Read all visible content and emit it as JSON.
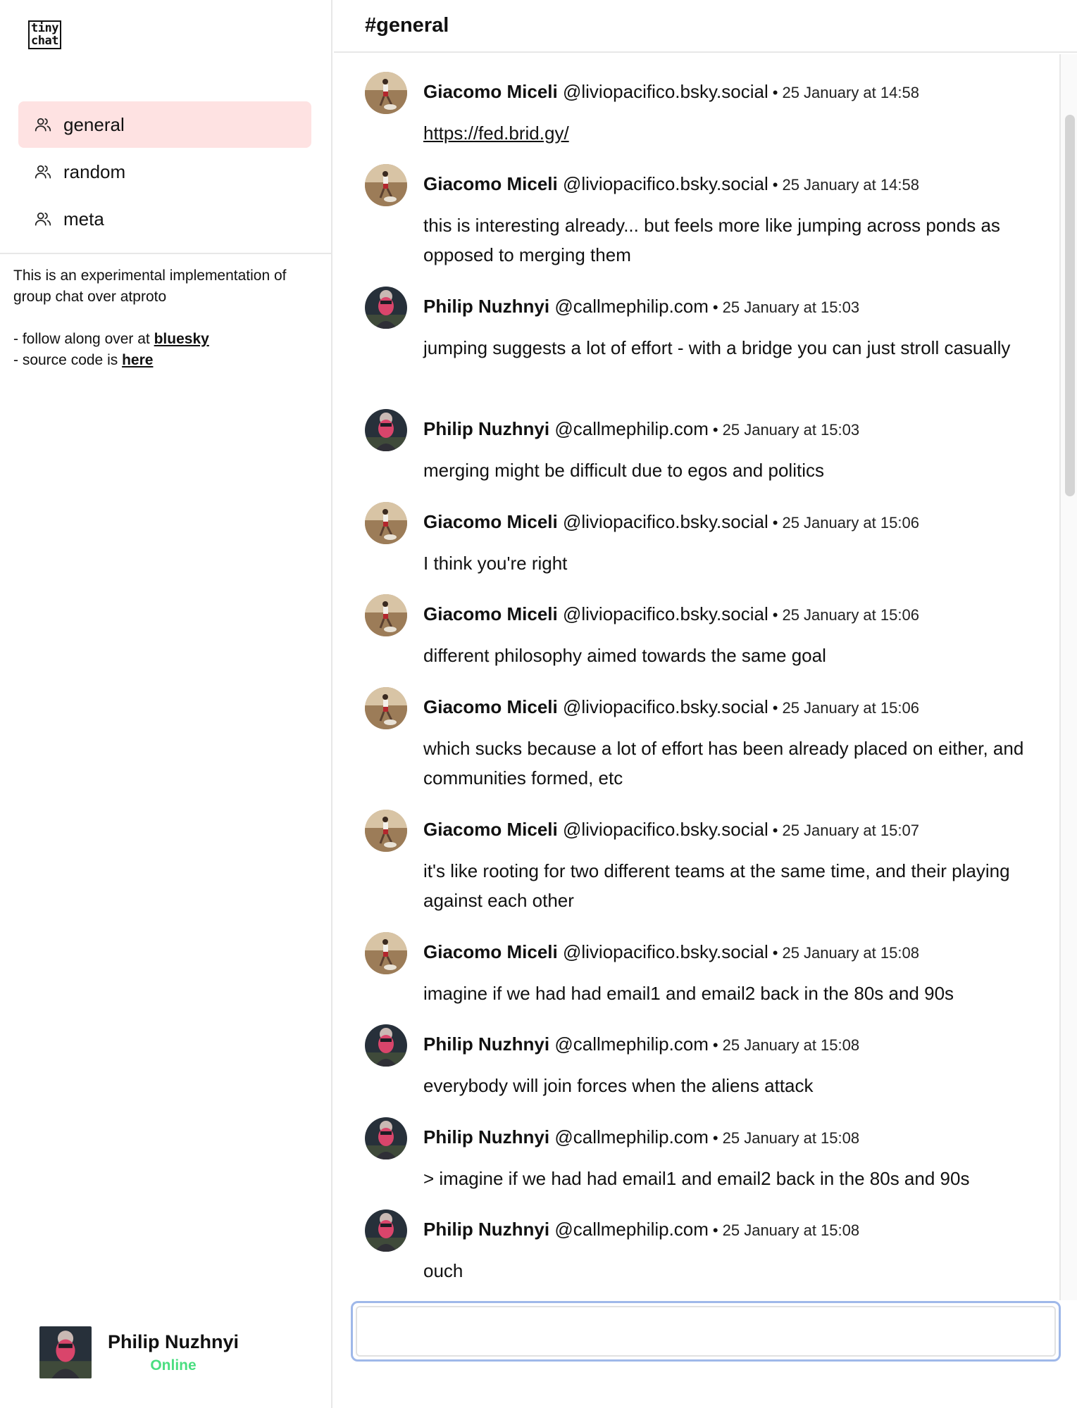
{
  "app": {
    "logo_line1": "tiny",
    "logo_line2": "chat"
  },
  "sidebar": {
    "channels": [
      {
        "label": "general",
        "active": true,
        "icon": "users-icon"
      },
      {
        "label": "random",
        "active": false,
        "icon": "users-icon"
      },
      {
        "label": "meta",
        "active": false,
        "icon": "users-icon"
      }
    ],
    "about": {
      "intro": "This is an experimental implementation of group chat over atproto",
      "follow_prefix": "- follow along over at ",
      "follow_link": "bluesky",
      "source_prefix": "- source code is ",
      "source_link": "here"
    },
    "current_user": {
      "name": "Philip Nuzhnyi",
      "status": "Online",
      "status_color": "#4ade80"
    }
  },
  "channel": {
    "title": "#general"
  },
  "messages": [
    {
      "author": "Giacomo Miceli",
      "handle": "@liviopacifico.bsky.social",
      "time": "25 January at 14:58",
      "text": "https://fed.brid.gy/",
      "is_link": true,
      "avatar": "giacomo"
    },
    {
      "author": "Giacomo Miceli",
      "handle": "@liviopacifico.bsky.social",
      "time": "25 January at 14:58",
      "text": "this is interesting already... but feels more like jumping across ponds as opposed to merging them",
      "avatar": "giacomo"
    },
    {
      "author": "Philip Nuzhnyi",
      "handle": "@callmephilip.com",
      "time": "25 January at 15:03",
      "text": "jumping suggests a lot of effort - with a bridge you can just stroll casually",
      "avatar": "philip"
    },
    {
      "author": "Philip Nuzhnyi",
      "handle": "@callmephilip.com",
      "time": "25 January at 15:03",
      "text": "merging might be difficult due to egos and politics",
      "avatar": "philip"
    },
    {
      "author": "Giacomo Miceli",
      "handle": "@liviopacifico.bsky.social",
      "time": "25 January at 15:06",
      "text": "I think you're right",
      "avatar": "giacomo"
    },
    {
      "author": "Giacomo Miceli",
      "handle": "@liviopacifico.bsky.social",
      "time": "25 January at 15:06",
      "text": "different philosophy aimed towards the same goal",
      "avatar": "giacomo"
    },
    {
      "author": "Giacomo Miceli",
      "handle": "@liviopacifico.bsky.social",
      "time": "25 January at 15:06",
      "text": "which sucks because a lot of effort has been already placed on either, and communities formed, etc",
      "avatar": "giacomo"
    },
    {
      "author": "Giacomo Miceli",
      "handle": "@liviopacifico.bsky.social",
      "time": "25 January at 15:07",
      "text": "it's like rooting for two different teams at the same time, and their playing against each other",
      "avatar": "giacomo"
    },
    {
      "author": "Giacomo Miceli",
      "handle": "@liviopacifico.bsky.social",
      "time": "25 January at 15:08",
      "text": "imagine if we had had email1 and email2 back in the 80s and 90s",
      "avatar": "giacomo"
    },
    {
      "author": "Philip Nuzhnyi",
      "handle": "@callmephilip.com",
      "time": "25 January at 15:08",
      "text": "everybody will join forces when the aliens attack",
      "avatar": "philip"
    },
    {
      "author": "Philip Nuzhnyi",
      "handle": "@callmephilip.com",
      "time": "25 January at 15:08",
      "text": "> imagine if we had had email1 and email2 back in the 80s and 90s",
      "avatar": "philip"
    },
    {
      "author": "Philip Nuzhnyi",
      "handle": "@callmephilip.com",
      "time": "25 January at 15:08",
      "text": "ouch",
      "avatar": "philip"
    }
  ],
  "composer": {
    "value": "",
    "placeholder": ""
  },
  "colors": {
    "active_channel_bg": "#fee2e2",
    "composer_focus_border": "#9fb8e9"
  }
}
